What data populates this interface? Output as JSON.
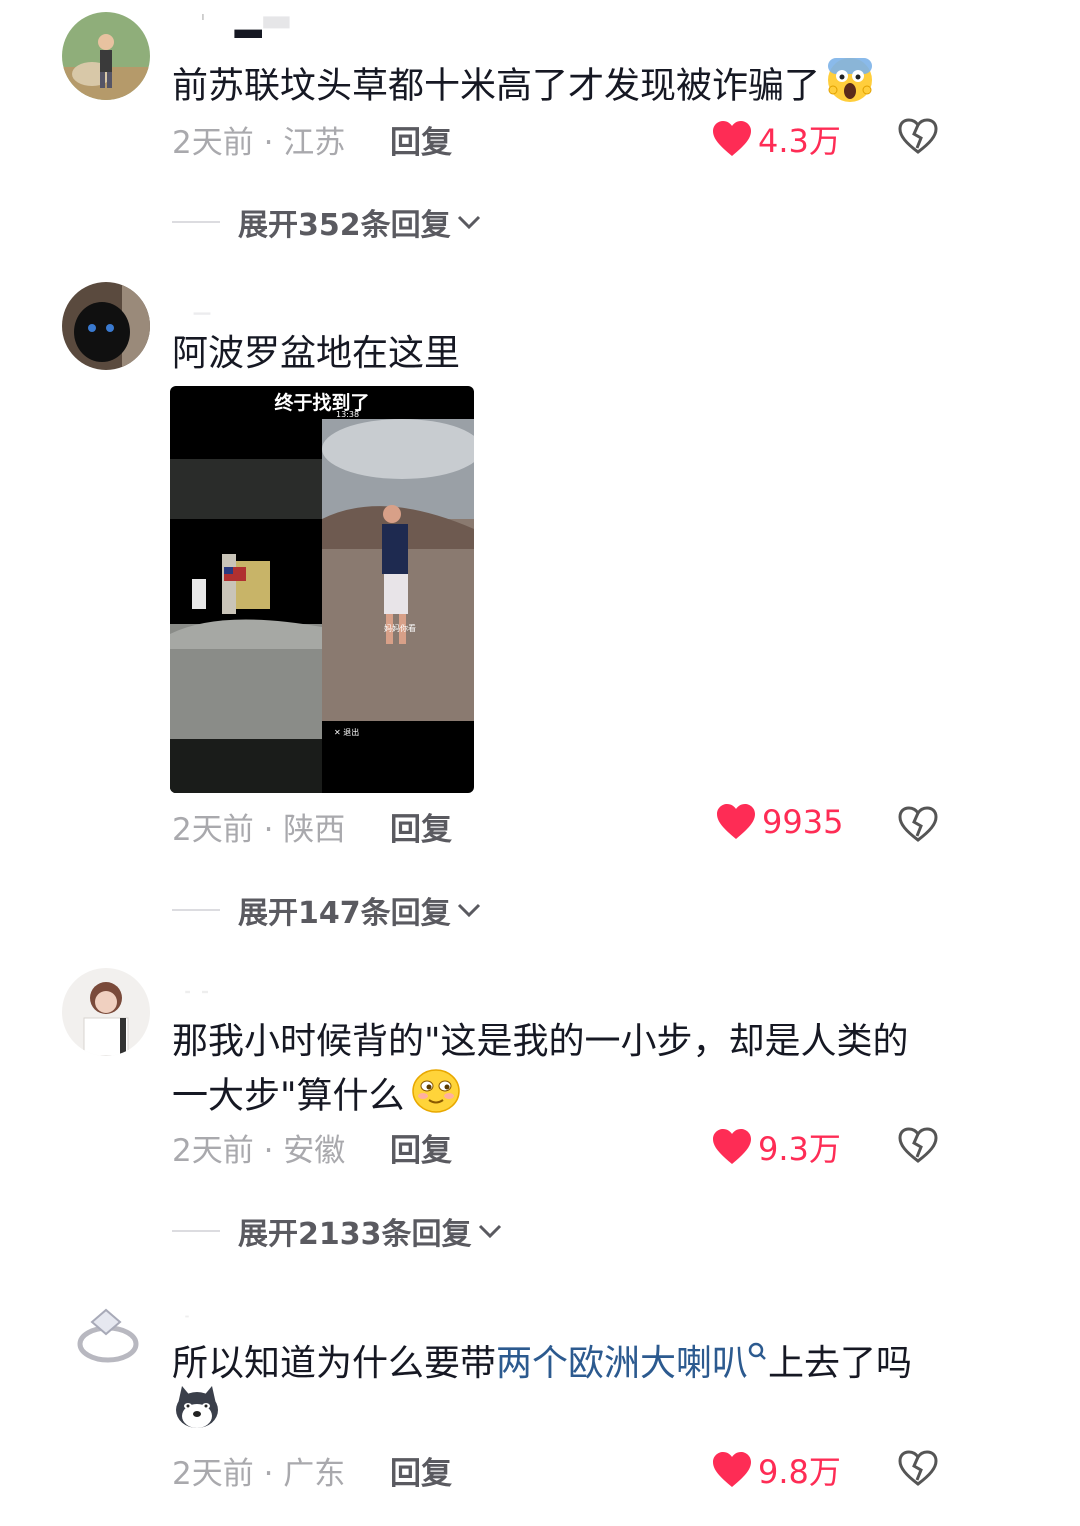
{
  "comments": [
    {
      "text": "前苏联坟头草都十米高了才发现被诈骗了",
      "emoji": "scream-emoji",
      "time_location": "2天前 · 江苏",
      "reply_label": "回复",
      "likes": "4.3万",
      "expand_label": "展开352条回复"
    },
    {
      "text": "阿波罗盆地在这里",
      "time_location": "2天前 · 陕西",
      "reply_label": "回复",
      "likes": "9935",
      "expand_label": "展开147条回复",
      "image": {
        "caption": "终于找到了",
        "status_time": "13:38",
        "exit_label": "✕ 退出",
        "subtitle": "妈妈你看"
      }
    },
    {
      "text_line1": "那我小时候背的\"这是我的一小步，却是人类的",
      "text_line2": "一大步\"算什么",
      "emoji": "smirk-emoji",
      "time_location": "2天前 · 安徽",
      "reply_label": "回复",
      "likes": "9.3万",
      "expand_label": "展开2133条回复"
    },
    {
      "text_before": "所以知道为什么要带",
      "link_text": "两个欧洲大喇叭",
      "text_after": "上去了吗",
      "emoji": "dog-emoji",
      "time_location": "2天前 · 广东",
      "reply_label": "回复",
      "likes": "9.8万"
    }
  ],
  "colors": {
    "like_red": "#fe2c55",
    "meta_gray": "#a9a9ad",
    "link_blue": "#2c5a8f"
  }
}
